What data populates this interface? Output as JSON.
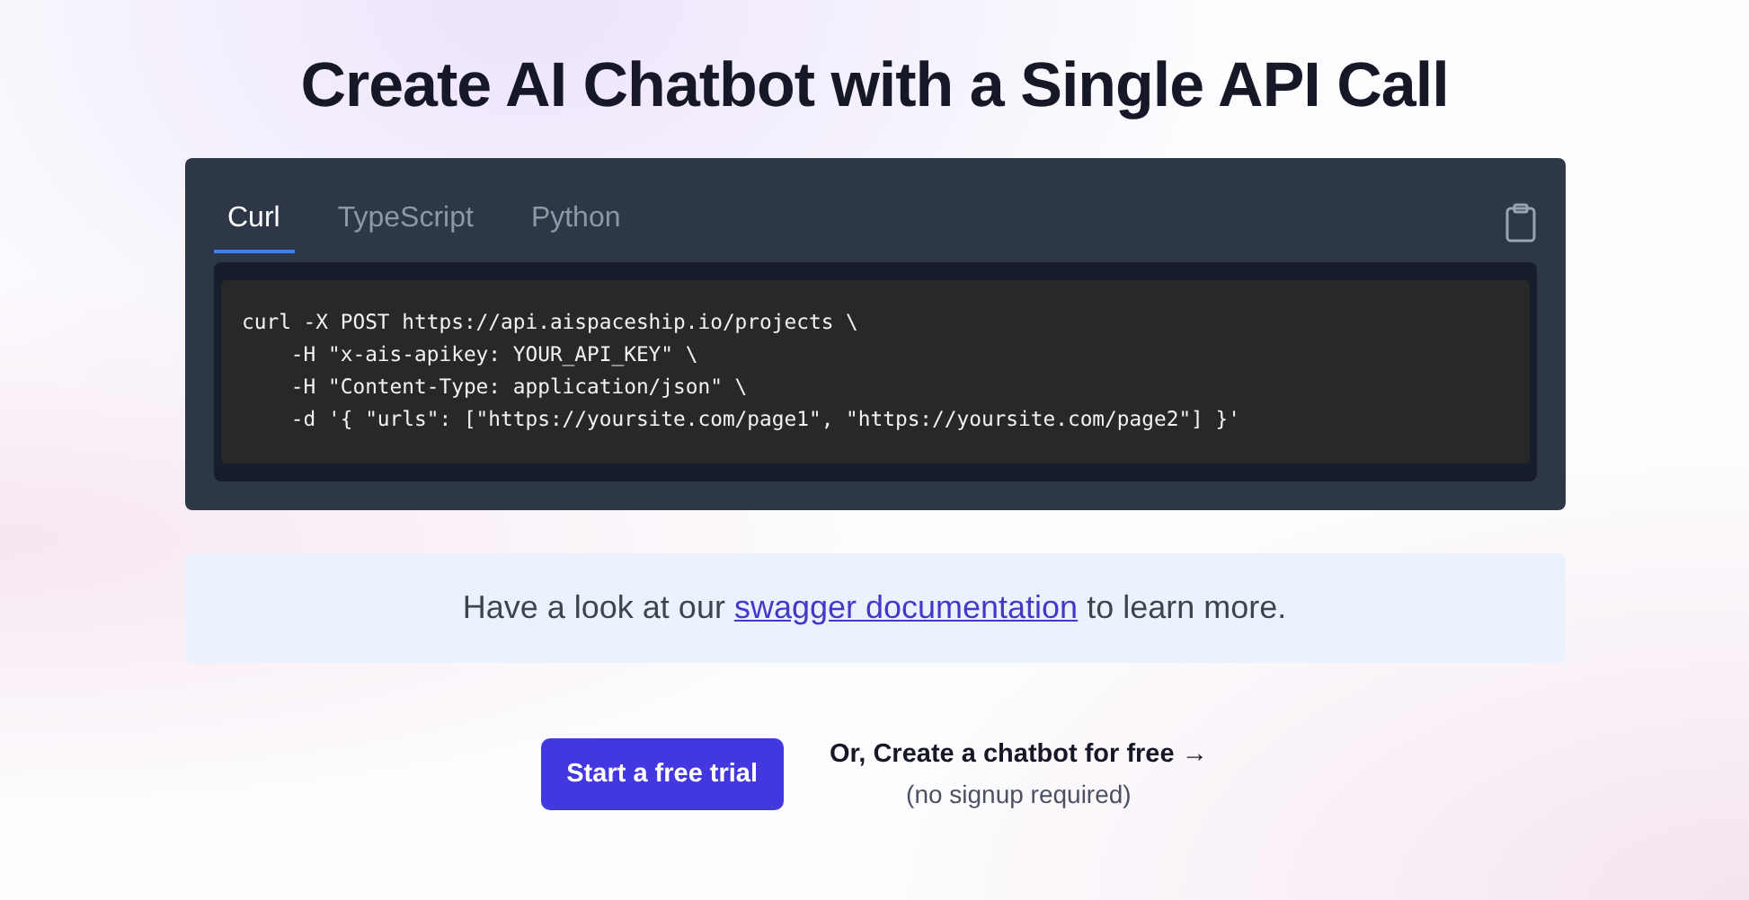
{
  "title": "Create AI Chatbot with a Single API Call",
  "tabs": [
    {
      "label": "Curl",
      "selected": true
    },
    {
      "label": "TypeScript",
      "selected": false
    },
    {
      "label": "Python",
      "selected": false
    }
  ],
  "code_lines": [
    "curl -X POST https://api.aispaceship.io/projects \\",
    "    -H \"x-ais-apikey: YOUR_API_KEY\" \\",
    "    -H \"Content-Type: application/json\" \\",
    "    -d '{ \"urls\": [\"https://yoursite.com/page1\", \"https://yoursite.com/page2\"] }'"
  ],
  "info": {
    "before": "Have a look at our ",
    "link": "swagger documentation",
    "after": " to learn more."
  },
  "primary_button": "Start a free trial",
  "secondary": {
    "link": "Or, Create a chatbot for free →",
    "note": "(no signup required)"
  }
}
